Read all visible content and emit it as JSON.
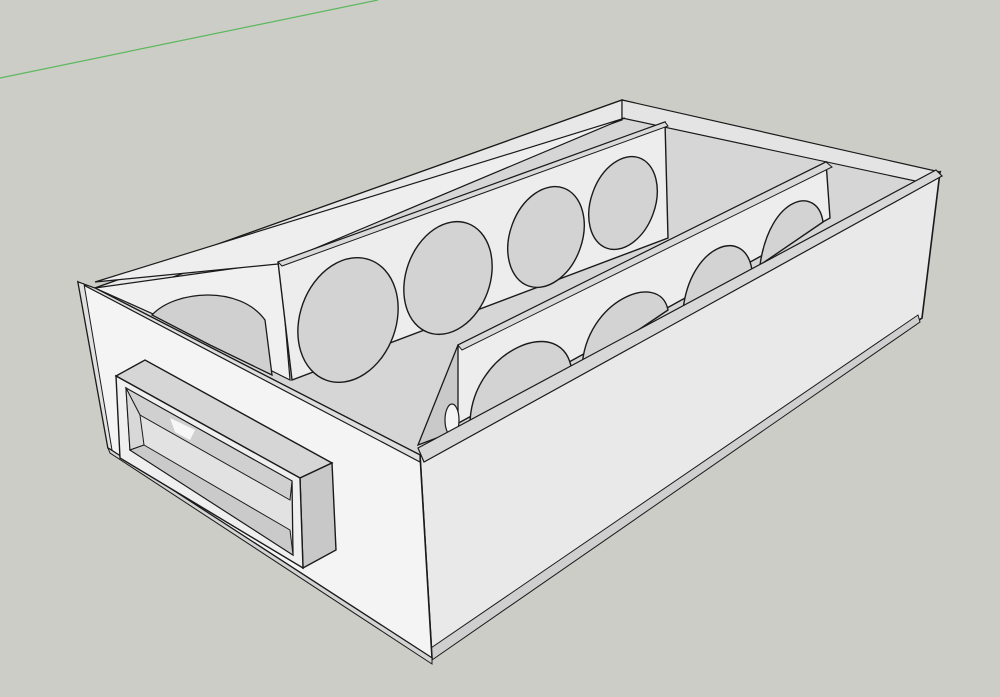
{
  "app": {
    "kind": "3d-modeling-viewport"
  },
  "scene": {
    "background_color": "#cdcdc8",
    "edge_color": "#1a1a1a",
    "face_colors": {
      "lit": "#f2f2f2",
      "light": "#e6e6e6",
      "mid": "#d9d9d9",
      "shade": "#c7c7c7",
      "dark": "#b8b8b8"
    },
    "axis_color": "#5cb85c",
    "object": {
      "type": "speaker-enclosure-box",
      "partitions": 2,
      "holes_back_panel": 4,
      "holes_front_panel": 4,
      "has_port": true
    }
  }
}
